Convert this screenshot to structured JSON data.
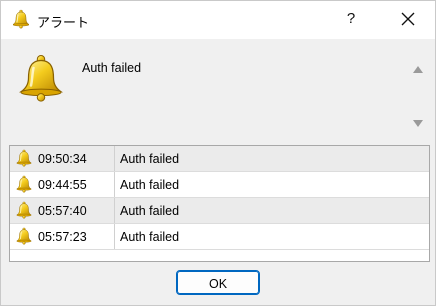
{
  "window": {
    "title": "アラート",
    "help_label": "?",
    "title_icon": "bell-icon",
    "close_icon": "close-icon"
  },
  "message": {
    "icon": "bell-icon",
    "text": "Auth failed"
  },
  "alerts": [
    {
      "time": "09:50:34",
      "text": "Auth failed"
    },
    {
      "time": "09:44:55",
      "text": "Auth failed"
    },
    {
      "time": "05:57:40",
      "text": "Auth failed"
    },
    {
      "time": "05:57:23",
      "text": "Auth failed"
    }
  ],
  "buttons": {
    "ok_label": "OK"
  },
  "colors": {
    "bell_gold": "#e8b400",
    "accent": "#0067c0"
  }
}
